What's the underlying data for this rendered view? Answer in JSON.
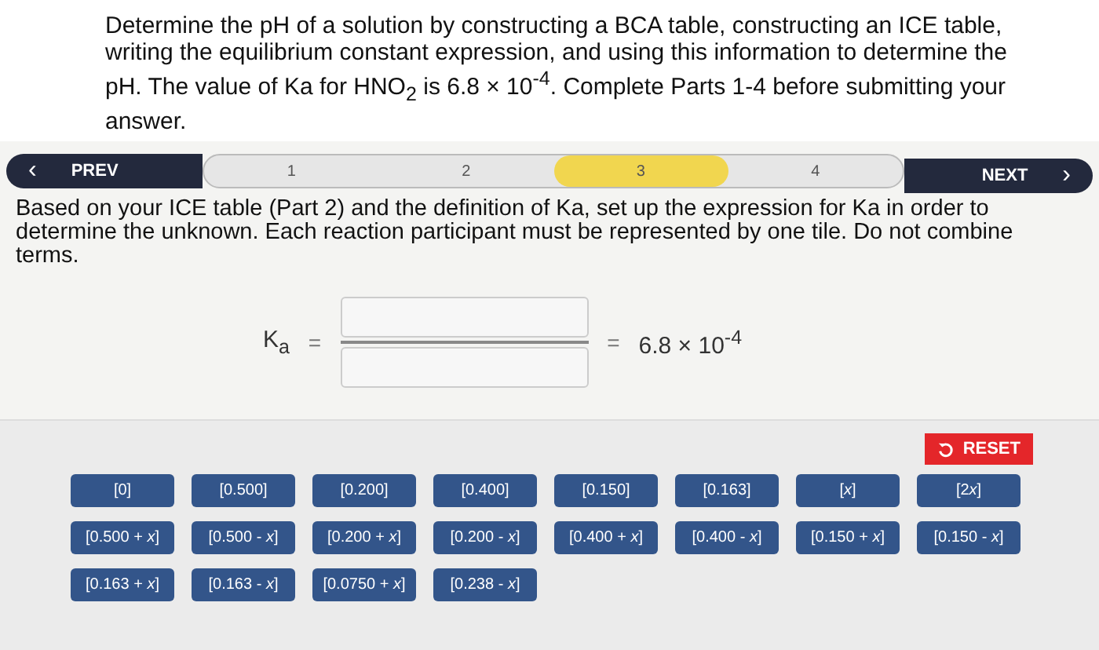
{
  "intro": "Determine the pH of a solution by constructing a BCA table, constructing an ICE table, writing the equilibrium constant expression, and using this information to determine the pH. The value of Ka for HNO$_{2}$ is 6.8 × 10$^{-4}$. Complete Parts 1-4 before submitting your answer.",
  "nav": {
    "prev": "PREV",
    "prev_icon": "‹",
    "next": "NEXT",
    "next_icon": "›",
    "steps": [
      {
        "label": "1",
        "selected": false
      },
      {
        "label": "2",
        "selected": false
      },
      {
        "label": "3",
        "selected": true
      },
      {
        "label": "4",
        "selected": false
      }
    ]
  },
  "instructions": "Based on your ICE table (Part 2) and the definition of Ka, set up the expression for Ka in order to determine the unknown. Each reaction participant must be represented by one tile. Do not combine terms.",
  "equation": {
    "lhs": "K$_{a}$",
    "equals": "=",
    "equals_right": "=",
    "value": "6.8 × 10$^{-4}$"
  },
  "reset": "RESET",
  "tiles": [
    {
      "pre": "[0]"
    },
    {
      "pre": "[0.500]"
    },
    {
      "pre": "[0.200]"
    },
    {
      "pre": "[0.400]"
    },
    {
      "pre": "[0.150]"
    },
    {
      "pre": "[0.163]"
    },
    {
      "pre": "[",
      "var": "x",
      "post": "]"
    },
    {
      "pre": "[2",
      "var": "x",
      "post": "]"
    },
    {
      "pre": "[0.500 + ",
      "var": "x",
      "post": "]"
    },
    {
      "pre": "[0.500 - ",
      "var": "x",
      "post": "]"
    },
    {
      "pre": "[0.200 + ",
      "var": "x",
      "post": "]"
    },
    {
      "pre": "[0.200 - ",
      "var": "x",
      "post": "]"
    },
    {
      "pre": "[0.400 + ",
      "var": "x",
      "post": "]"
    },
    {
      "pre": "[0.400 - ",
      "var": "x",
      "post": "]"
    },
    {
      "pre": "[0.150 + ",
      "var": "x",
      "post": "]"
    },
    {
      "pre": "[0.150 - ",
      "var": "x",
      "post": "]"
    },
    {
      "pre": "[0.163 + ",
      "var": "x",
      "post": "]"
    },
    {
      "pre": "[0.163 - ",
      "var": "x",
      "post": "]"
    },
    {
      "pre": "[0.0750 + ",
      "var": "x",
      "post": "]"
    },
    {
      "pre": "[0.238 - ",
      "var": "x",
      "post": "]"
    }
  ]
}
